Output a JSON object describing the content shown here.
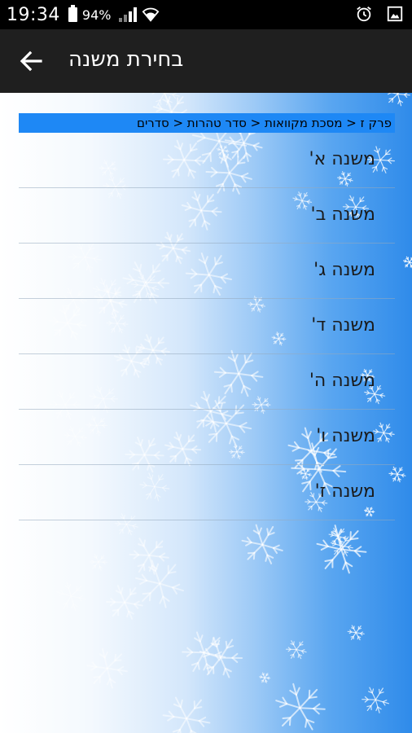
{
  "status_bar": {
    "time": "19:34",
    "battery": "94%"
  },
  "app_bar": {
    "title": "בחירת משנה",
    "back_icon": "arrow-left-icon"
  },
  "breadcrumb": "פרק ז < מסכת מקוואות < סדר טהרות < סדרים",
  "items": [
    {
      "label": "משנה א'"
    },
    {
      "label": "משנה ב'"
    },
    {
      "label": "משנה ג'"
    },
    {
      "label": "משנה ד'"
    },
    {
      "label": "משנה ה'"
    },
    {
      "label": "משנה ו'"
    },
    {
      "label": "משנה ז'"
    }
  ],
  "colors": {
    "status_bar": "#000000",
    "app_bar": "#1f1f1f",
    "breadcrumb_bg": "#1e88f5",
    "background_accent": "#2f8bea"
  }
}
